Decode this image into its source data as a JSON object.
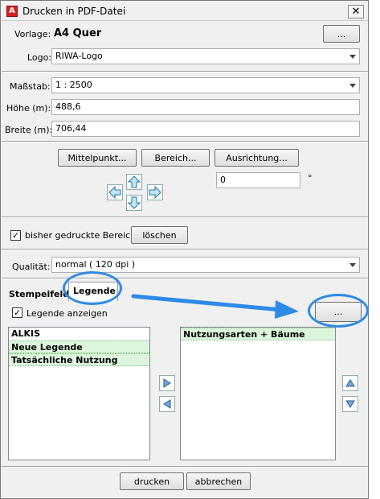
{
  "window": {
    "title": "Drucken in PDF-Datei",
    "app_icon_text": "A",
    "close_glyph": "✕"
  },
  "vorlage": {
    "label": "Vorlage:",
    "value": "A4 Quer",
    "browse_label": "..."
  },
  "logo": {
    "label": "Logo:",
    "value": "RIWA-Logo"
  },
  "massstab": {
    "label": "Maßstab:",
    "value": "1 : 2500"
  },
  "hoehe": {
    "label": "Höhe (m):",
    "value": "488,6"
  },
  "breite": {
    "label": "Breite (m):",
    "value": "706,44"
  },
  "positioning": {
    "mittelpunkt_label": "Mittelpunkt...",
    "bereich_label": "Bereich...",
    "ausrichtung_label": "Ausrichtung...",
    "angle_value": "0",
    "degree_symbol": "°",
    "pan_icons": [
      "arrow-up-icon",
      "arrow-left-icon",
      "arrow-down-icon",
      "arrow-right-icon"
    ]
  },
  "printed_areas": {
    "checkbox_label": "bisher gedruckte Bereiche",
    "checked": true,
    "clear_label": "löschen"
  },
  "quality": {
    "label": "Qualität:",
    "value": "normal ( 120 dpi )"
  },
  "tabs": [
    {
      "label": "Stempelfeld",
      "active": false
    },
    {
      "label": "Legende",
      "active": true
    }
  ],
  "legend": {
    "show_label": "Legende anzeigen",
    "show_checked": true,
    "browse_label": "...",
    "available": [
      {
        "text": "ALKIS",
        "selected": false
      },
      {
        "text": "Neue Legende",
        "selected": true
      },
      {
        "text": "Tatsächliche Nutzung",
        "selected": true
      }
    ],
    "chosen": [
      {
        "text": "Nutzungsarten + Bäume",
        "selected": true
      }
    ],
    "move_right_icon": "triangle-right-icon",
    "move_left_icon": "triangle-left-icon",
    "move_up_icon": "triangle-up-icon",
    "move_down_icon": "triangle-down-icon"
  },
  "footer": {
    "print_label": "drucken",
    "cancel_label": "abbrechen"
  },
  "colors": {
    "highlight": "#2e8ae6",
    "selection": "#ddf5dd"
  }
}
